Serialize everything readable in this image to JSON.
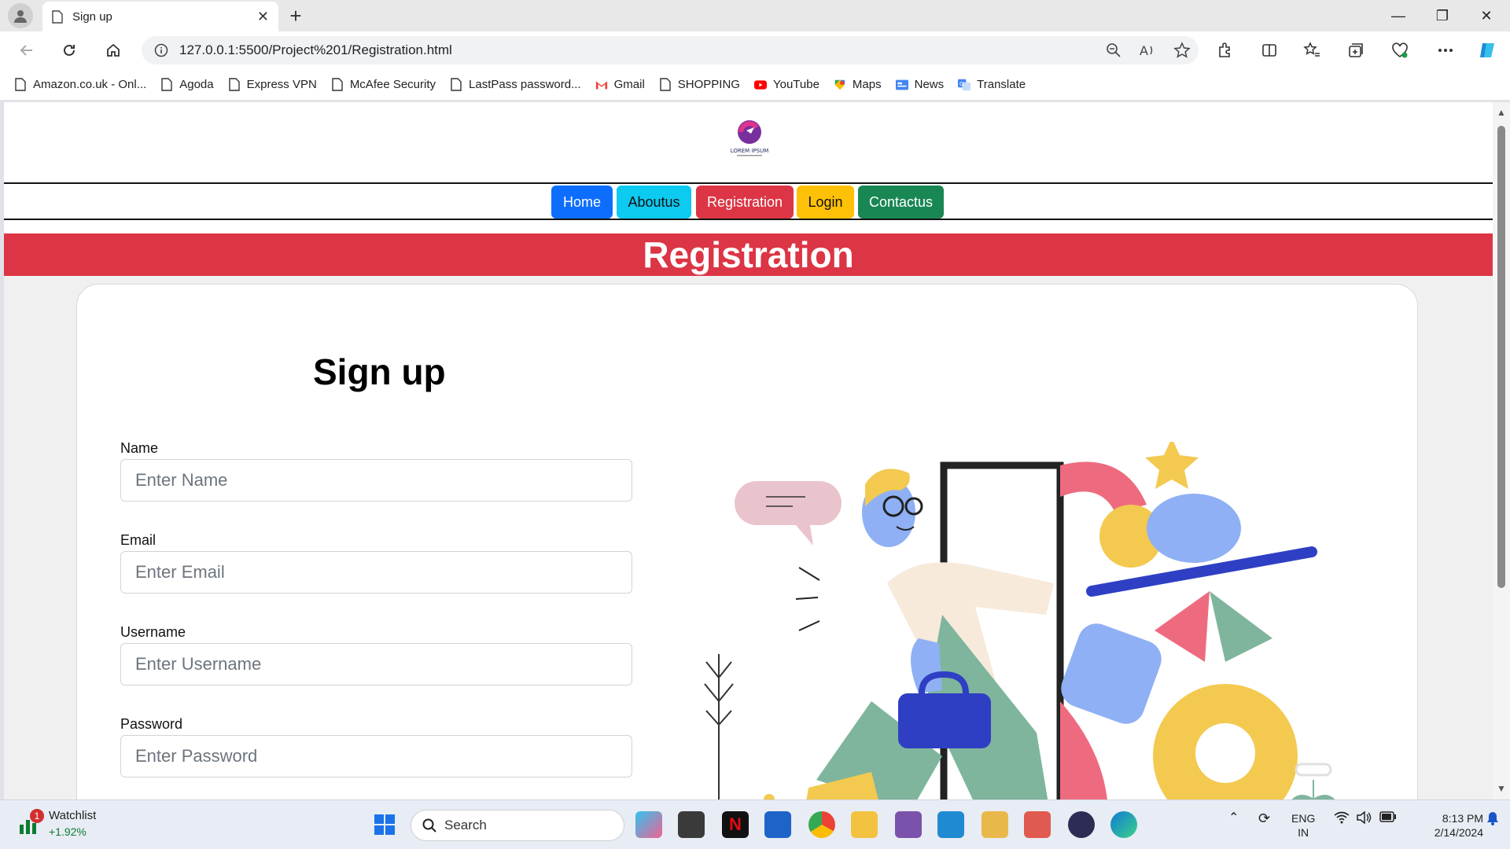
{
  "browser": {
    "tab_title": "Sign up",
    "tab_close": "✕",
    "new_tab": "+",
    "url": "127.0.0.1:5500/Project%201/Registration.html",
    "window_controls": [
      "—",
      "❐",
      "✕"
    ]
  },
  "bookmarks": [
    {
      "label": "Amazon.co.uk - Onl...",
      "icon": "page-icon"
    },
    {
      "label": "Agoda",
      "icon": "page-icon"
    },
    {
      "label": "Express VPN",
      "icon": "page-icon"
    },
    {
      "label": "McAfee Security",
      "icon": "page-icon"
    },
    {
      "label": "LastPass password...",
      "icon": "page-icon"
    },
    {
      "label": "Gmail",
      "icon": "gmail-icon"
    },
    {
      "label": "SHOPPING",
      "icon": "page-icon"
    },
    {
      "label": "YouTube",
      "icon": "youtube-icon"
    },
    {
      "label": "Maps",
      "icon": "maps-icon"
    },
    {
      "label": "News",
      "icon": "news-icon"
    },
    {
      "label": "Translate",
      "icon": "translate-icon"
    }
  ],
  "page": {
    "logo_text": "LOREM IPSUM",
    "nav": [
      {
        "label": "Home",
        "color": "#0d6efd"
      },
      {
        "label": "Aboutus",
        "color": "#0dcaf0"
      },
      {
        "label": "Registration",
        "color": "#dc3545"
      },
      {
        "label": "Login",
        "color": "#ffc107"
      },
      {
        "label": "Contactus",
        "color": "#198754"
      }
    ],
    "banner_title": "Registration",
    "form": {
      "title": "Sign up",
      "fields": [
        {
          "label": "Name",
          "placeholder": "Enter Name"
        },
        {
          "label": "Email",
          "placeholder": "Enter Email"
        },
        {
          "label": "Username",
          "placeholder": "Enter Username"
        },
        {
          "label": "Password",
          "placeholder": "Enter Password"
        }
      ]
    }
  },
  "taskbar": {
    "watchlist_label": "Watchlist",
    "watchlist_change": "+1.92%",
    "watchlist_badge": "1",
    "search_label": "Search",
    "language": "ENG",
    "region": "IN",
    "time": "8:13 PM",
    "date": "2/14/2024"
  }
}
